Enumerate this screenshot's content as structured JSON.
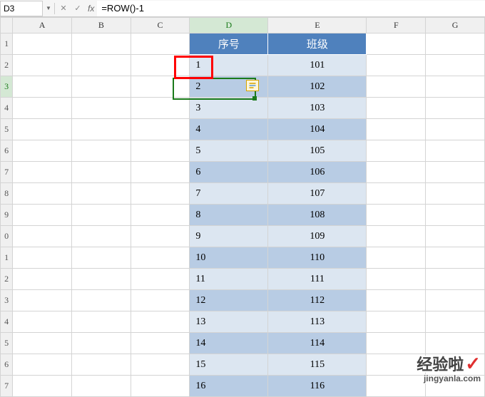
{
  "formula_bar": {
    "name_box": "D3",
    "formula": "=ROW()-1"
  },
  "columns": [
    "A",
    "B",
    "C",
    "D",
    "E",
    "F",
    "G"
  ],
  "row_headers": [
    "1",
    "2",
    "3",
    "4",
    "5",
    "6",
    "7",
    "8",
    "9",
    "0",
    "1",
    "2",
    "3",
    "4",
    "5",
    "6",
    "7"
  ],
  "headers": {
    "d": "序号",
    "e": "班级"
  },
  "rows": [
    {
      "d": "1",
      "e": "101"
    },
    {
      "d": "2",
      "e": "102"
    },
    {
      "d": "3",
      "e": "103"
    },
    {
      "d": "4",
      "e": "104"
    },
    {
      "d": "5",
      "e": "105"
    },
    {
      "d": "6",
      "e": "106"
    },
    {
      "d": "7",
      "e": "107"
    },
    {
      "d": "8",
      "e": "108"
    },
    {
      "d": "9",
      "e": "109"
    },
    {
      "d": "10",
      "e": "110"
    },
    {
      "d": "11",
      "e": "111"
    },
    {
      "d": "12",
      "e": "112"
    },
    {
      "d": "13",
      "e": "113"
    },
    {
      "d": "14",
      "e": "114"
    },
    {
      "d": "15",
      "e": "115"
    },
    {
      "d": "16",
      "e": "116"
    }
  ],
  "watermark": {
    "main": "经验啦",
    "sub": "jingyanla.com"
  },
  "chart_data": {
    "type": "table",
    "title": "",
    "columns": [
      "序号",
      "班级"
    ],
    "rows": [
      [
        1,
        101
      ],
      [
        2,
        102
      ],
      [
        3,
        103
      ],
      [
        4,
        104
      ],
      [
        5,
        105
      ],
      [
        6,
        106
      ],
      [
        7,
        107
      ],
      [
        8,
        108
      ],
      [
        9,
        109
      ],
      [
        10,
        110
      ],
      [
        11,
        111
      ],
      [
        12,
        112
      ],
      [
        13,
        113
      ],
      [
        14,
        114
      ],
      [
        15,
        115
      ],
      [
        16,
        116
      ]
    ]
  }
}
